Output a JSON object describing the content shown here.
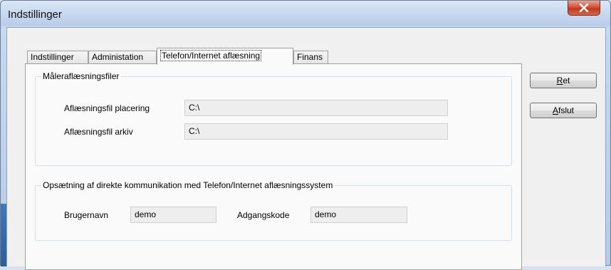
{
  "window": {
    "title": "Indstillinger"
  },
  "tabs": [
    {
      "label": "Indstillinger",
      "active": false
    },
    {
      "label": "Administation",
      "active": false
    },
    {
      "label": "Telefon/Internet aflæsning",
      "active": true
    },
    {
      "label": "Finans",
      "active": false
    }
  ],
  "group_files": {
    "title": "Måleraflæsningsfiler",
    "location_label": "Aflæsningsfil placering",
    "location_value": "C:\\",
    "archive_label": "Aflæsningsfil arkiv",
    "archive_value": "C:\\"
  },
  "group_comm": {
    "title": "Opsætning af direkte kommunikation med Telefon/Internet aflæsningssystem",
    "username_label": "Brugernavn",
    "username_value": "demo",
    "password_label": "Adgangskode",
    "password_value": "demo"
  },
  "buttons": {
    "ret_first": "R",
    "ret_rest": "et",
    "afslut_first": "A",
    "afslut_rest": "fslut"
  },
  "colors": {
    "close_button": "#c7452b",
    "titlebar": "#c4d6ee"
  }
}
